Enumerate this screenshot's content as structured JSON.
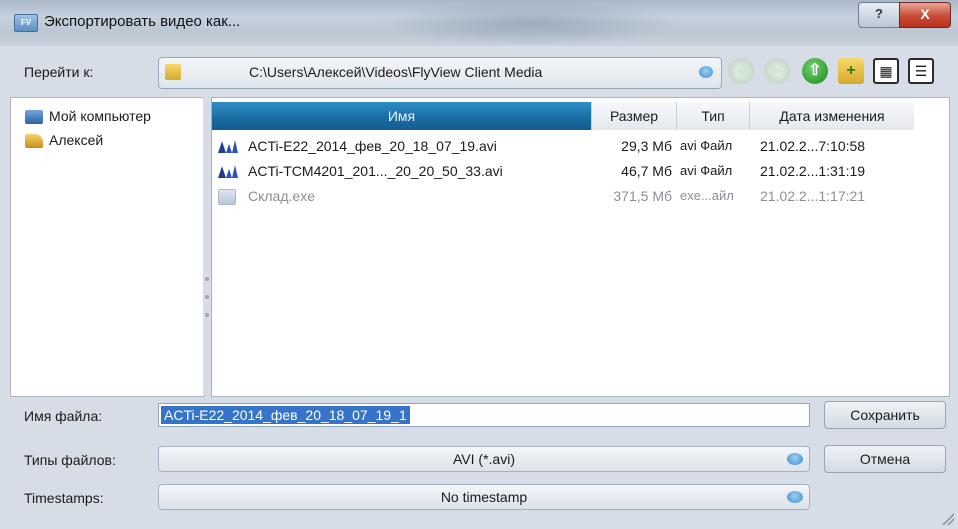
{
  "window": {
    "title": "Экспортировать видео как...",
    "app_icon": "app-icon",
    "help_label": "?",
    "close_label": "X"
  },
  "navigation": {
    "path_label": "Перейти к:",
    "path": "C:\\Users\\Алексей\\Videos\\FlyView Client Media",
    "icons": [
      "back-icon",
      "forward-icon",
      "up-folder-icon",
      "new-folder-icon",
      "view-thumbnails-icon",
      "view-details-icon"
    ]
  },
  "sidebar": {
    "items": [
      {
        "label": "Мой компьютер",
        "icon": "computer-icon"
      },
      {
        "label": "Алексей",
        "icon": "user-folder-icon"
      }
    ]
  },
  "file_list": {
    "columns": [
      "Имя",
      "Размер",
      "Тип",
      "Дата изменения"
    ],
    "rows": [
      {
        "name": "ACTi-E22_2014_фев_20_18_07_19.avi",
        "size": "29,3 Мб",
        "type": "avi Файл",
        "date": "21.02.2...7:10:58",
        "icon": "video-file-icon"
      },
      {
        "name": "ACTi-TCM4201_201..._20_20_50_33.avi",
        "size": "46,7 Мб",
        "type": "avi Файл",
        "date": "21.02.2...1:31:19",
        "icon": "video-file-icon"
      },
      {
        "name": "Склад.exe",
        "size": "371,5 Мб",
        "type": "exe...айл",
        "date": "21.02.2...1:17:21",
        "icon": "exe-file-icon"
      }
    ]
  },
  "form": {
    "filename_label": "Имя файла:",
    "filename_value": "ACTi-E22_2014_фев_20_18_07_19_1",
    "filetype_label": "Типы файлов:",
    "filetype_value": "AVI (*.avi)",
    "timestamps_label": "Timestamps:",
    "timestamps_value": "No timestamp",
    "save_label": "Сохранить",
    "cancel_label": "Отмена"
  },
  "colors": {
    "header_active": "#1a6aa2",
    "selection": "#3574c9",
    "close_button": "#c74b35"
  }
}
